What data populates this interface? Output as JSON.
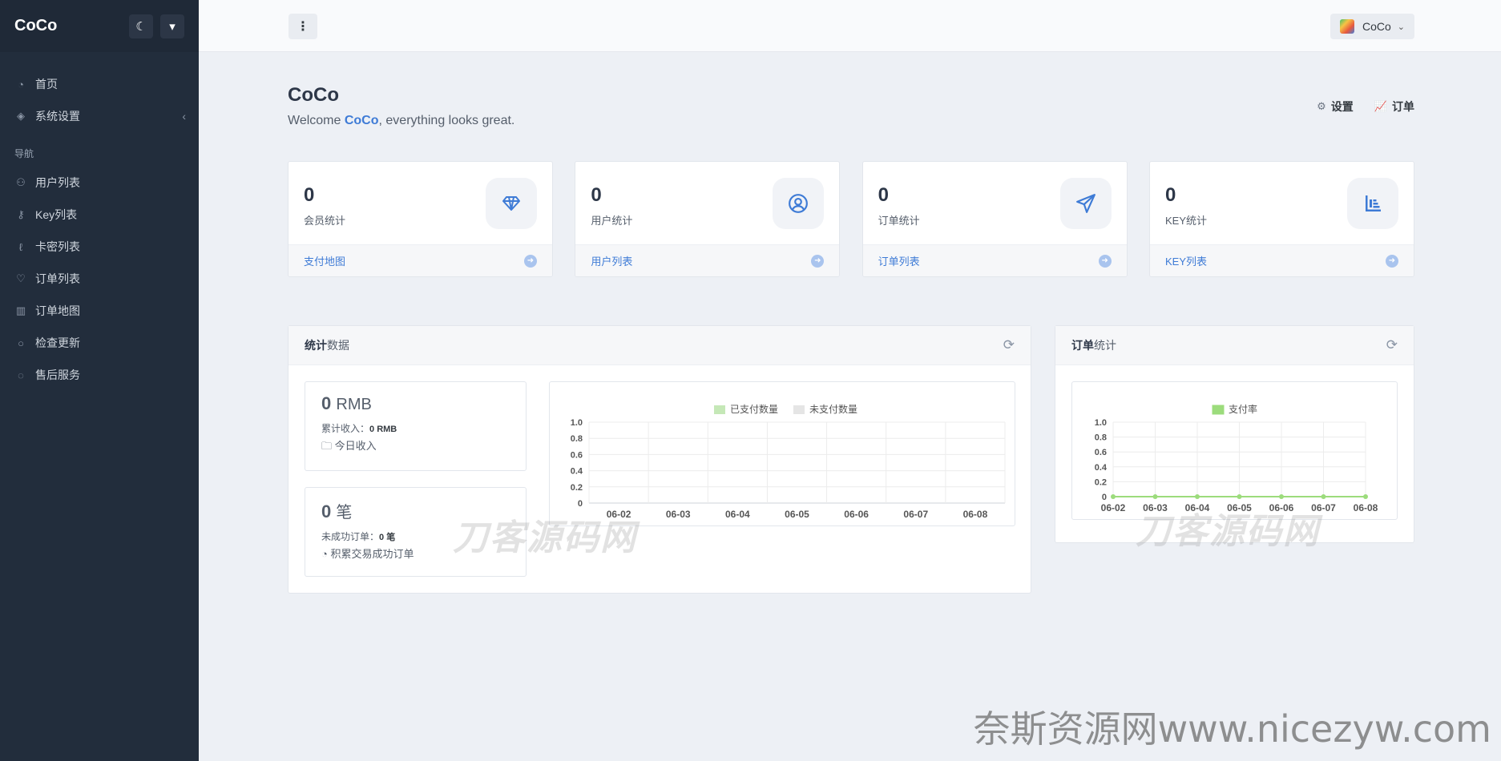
{
  "app": {
    "brand": "CoCo"
  },
  "sidebar": {
    "items": [
      {
        "label": "首页",
        "icon": "dashboard-icon"
      },
      {
        "label": "系统设置",
        "icon": "layers-icon",
        "caret": "‹"
      }
    ],
    "nav_heading": "导航",
    "nav_items": [
      {
        "label": "用户列表",
        "icon": "users-icon"
      },
      {
        "label": "Key列表",
        "icon": "key-icon"
      },
      {
        "label": "卡密列表",
        "icon": "card-icon"
      },
      {
        "label": "订单列表",
        "icon": "heart-icon"
      },
      {
        "label": "订单地图",
        "icon": "map-icon"
      },
      {
        "label": "检查更新",
        "icon": "chat-icon"
      },
      {
        "label": "售后服务",
        "icon": "comments-icon"
      }
    ]
  },
  "topbar": {
    "user_name": "CoCo"
  },
  "hero": {
    "title": "CoCo",
    "welcome_prefix": "Welcome ",
    "welcome_name": "CoCo",
    "welcome_suffix": ", everything looks great.",
    "link_settings": "设置",
    "link_orders": "订单"
  },
  "stats": [
    {
      "value": "0",
      "label": "会员统计",
      "link": "支付地图",
      "icon": "diamond-icon"
    },
    {
      "value": "0",
      "label": "用户统计",
      "link": "用户列表",
      "icon": "user-circle-icon"
    },
    {
      "value": "0",
      "label": "订单统计",
      "link": "订单列表",
      "icon": "paper-plane-icon"
    },
    {
      "value": "0",
      "label": "KEY统计",
      "link": "KEY列表",
      "icon": "bar-chart-icon"
    }
  ],
  "panel_stats": {
    "title_bold": "统计",
    "title_rest": "数据",
    "revenue_value": "0",
    "revenue_unit": "RMB",
    "revenue_total_label": "累计收入：",
    "revenue_total_value": "0 RMB",
    "revenue_today": "今日收入",
    "orders_value": "0",
    "orders_unit": "笔",
    "orders_failed_label": "未成功订单：",
    "orders_failed_value": "0 笔",
    "orders_success": "积累交易成功订单"
  },
  "panel_orders": {
    "title_bold": "订单",
    "title_rest": "统计"
  },
  "chart_data": [
    {
      "type": "bar",
      "categories": [
        "06-02",
        "06-03",
        "06-04",
        "06-05",
        "06-06",
        "06-07",
        "06-08"
      ],
      "series": [
        {
          "name": "已支付数量",
          "values": [
            0,
            0,
            0,
            0,
            0,
            0,
            0
          ],
          "color": "#c5e8b7"
        },
        {
          "name": "未支付数量",
          "values": [
            0,
            0,
            0,
            0,
            0,
            0,
            0
          ],
          "color": "#e5e5e5"
        }
      ],
      "yticks": [
        "0",
        "0.2",
        "0.4",
        "0.6",
        "0.8",
        "1.0"
      ],
      "ylim": [
        0,
        1.0
      ],
      "legend": "top-center",
      "grid": true
    },
    {
      "type": "line",
      "categories": [
        "06-02",
        "06-03",
        "06-04",
        "06-05",
        "06-06",
        "06-07",
        "06-08"
      ],
      "series": [
        {
          "name": "支付率",
          "values": [
            0,
            0,
            0,
            0,
            0,
            0,
            0
          ],
          "color": "#9cdc7c"
        }
      ],
      "yticks": [
        "0",
        "0.2",
        "0.4",
        "0.6",
        "0.8",
        "1.0"
      ],
      "ylim": [
        0,
        1.0
      ],
      "legend": "top-center",
      "grid": true
    }
  ],
  "watermarks": {
    "chart_wm": "刀客源码网",
    "site_wm": "奈斯资源网www.nicezyw.com"
  }
}
